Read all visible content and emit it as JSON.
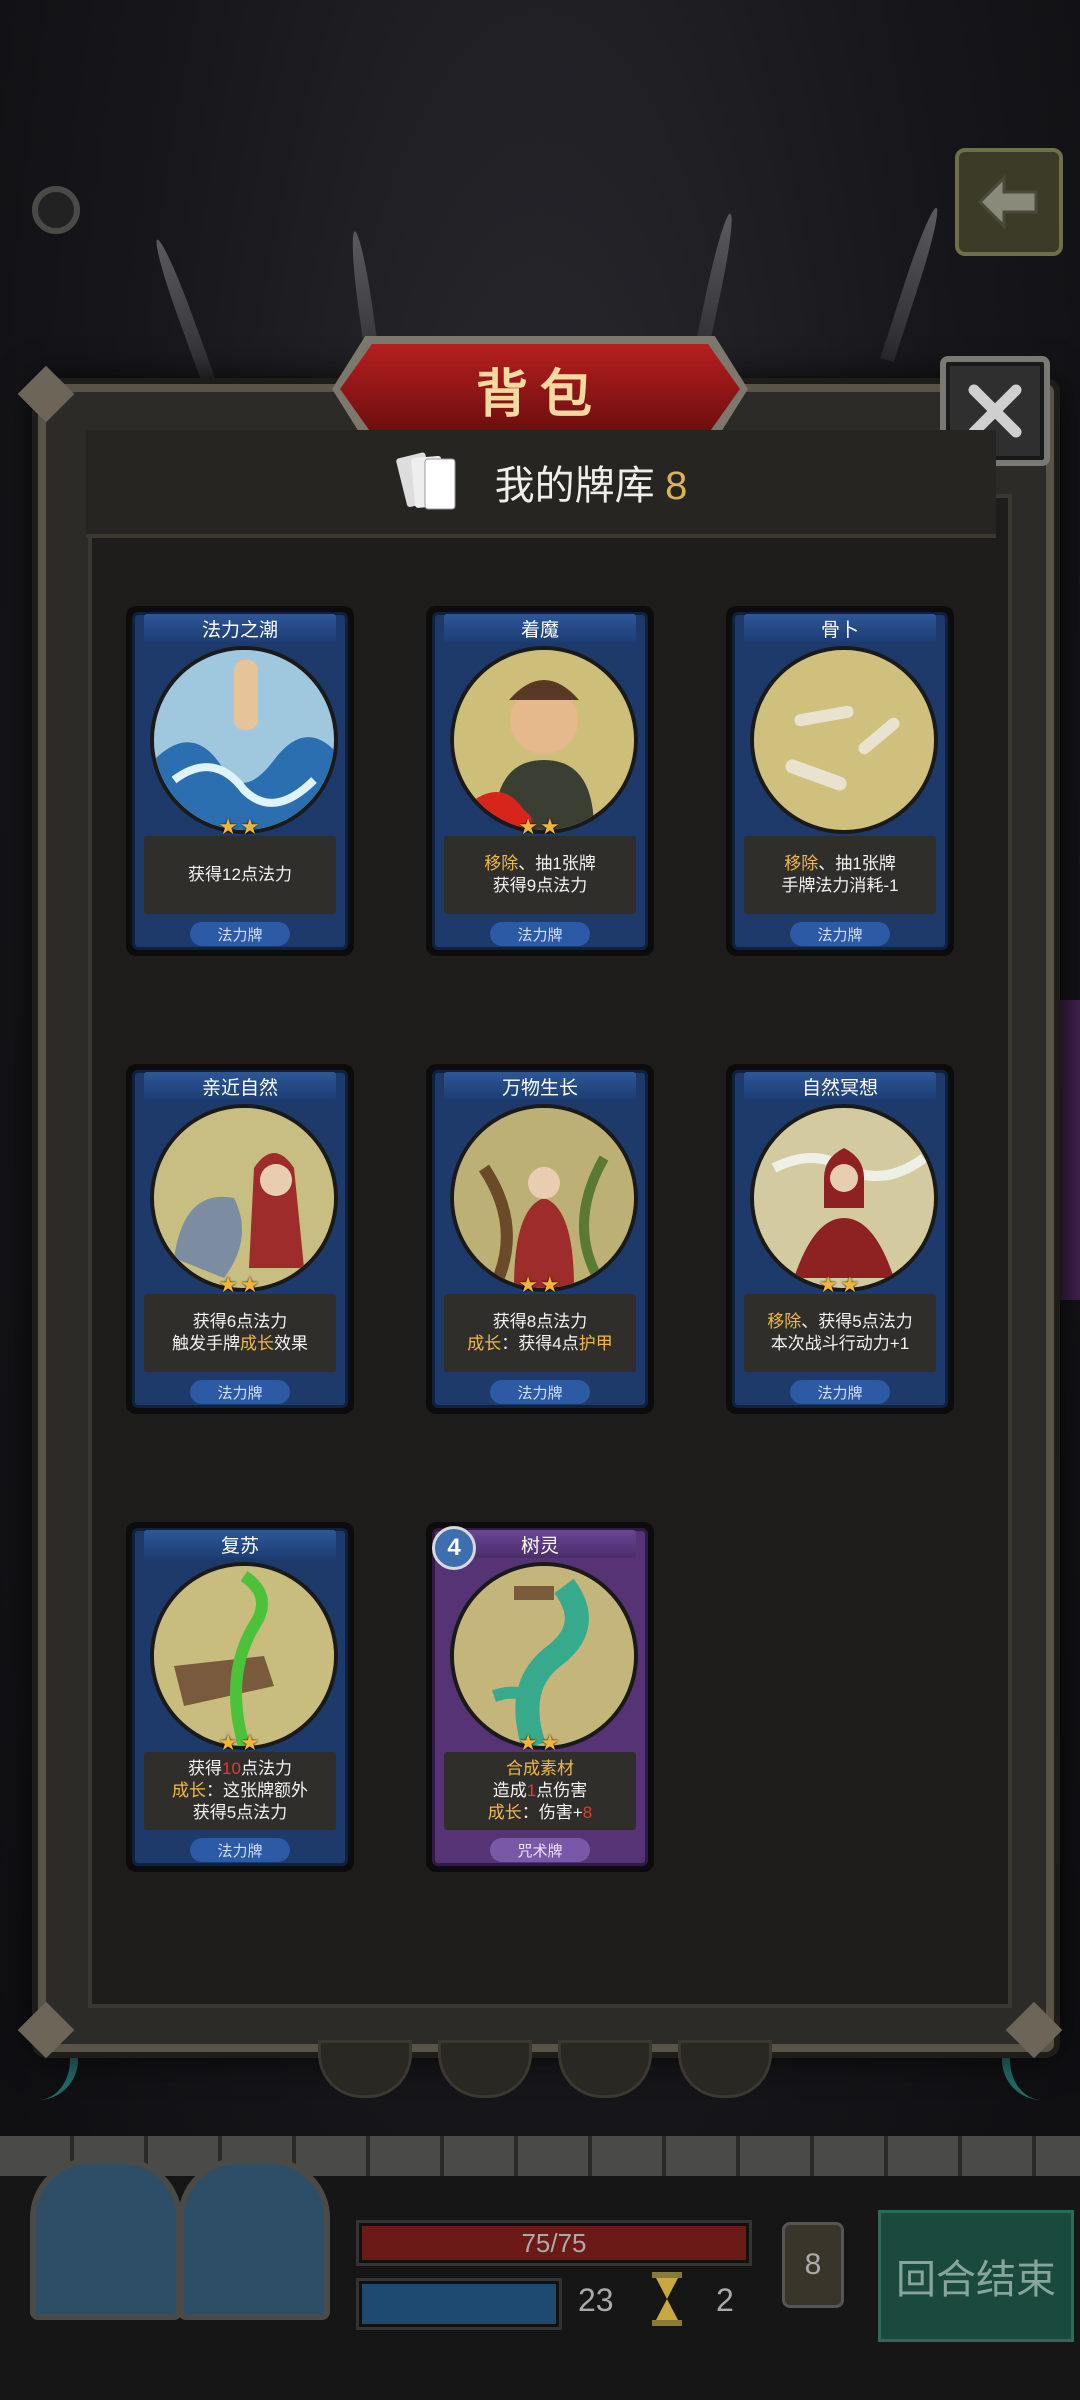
{
  "header": {
    "title": "背包"
  },
  "deck": {
    "title": "我的牌库",
    "count": "8"
  },
  "cards": [
    {
      "name": "法力之潮",
      "stars": "★★",
      "desc": [
        "获得12点法力"
      ],
      "type": "法力牌"
    },
    {
      "name": "着魔",
      "stars": "★★",
      "desc_html": [
        [
          "移除",
          "、抽1张牌"
        ],
        [
          "获得9点法力"
        ]
      ],
      "type": "法力牌"
    },
    {
      "name": "骨卜",
      "stars": "",
      "desc_html": [
        [
          "移除",
          "、抽1张牌"
        ],
        [
          "手牌法力消耗-1"
        ]
      ],
      "type": "法力牌"
    },
    {
      "name": "亲近自然",
      "stars": "★★",
      "type": "法力牌"
    },
    {
      "name": "万物生长",
      "stars": "★★",
      "type": "法力牌"
    },
    {
      "name": "自然冥想",
      "stars": "★★",
      "type": "法力牌"
    },
    {
      "name": "复苏",
      "stars": "★★",
      "type": "法力牌"
    },
    {
      "name": "树灵",
      "stars": "★★",
      "cost": "4",
      "type": "咒术牌"
    }
  ],
  "card_text": {
    "c0": "获得12点法力",
    "c1a_hl": "移除",
    "c1a": "、抽1张牌",
    "c1b": "获得9点法力",
    "c2a_hl": "移除",
    "c2a": "、抽1张牌",
    "c2b": "手牌法力消耗-1",
    "c3a": "获得6点法力",
    "c3b_pre": "触发手牌",
    "c3b_hl": "成长",
    "c3b_post": "效果",
    "c4a": "获得8点法力",
    "c4b_hl": "成长",
    "c4b_mid": "：获得4点",
    "c4b_hl2": "护甲",
    "c5a_hl": "移除",
    "c5a": "、获得5点法力",
    "c5b": "本次战斗行动力+1",
    "c6a_pre": "获得",
    "c6a_red": "10",
    "c6a_post": "点法力",
    "c6b_hl": "成长",
    "c6b": "：这张牌额外",
    "c6c": "获得5点法力",
    "c7a_hl": "合成素材",
    "c7b_pre": "造成",
    "c7b_red": "1",
    "c7b_post": "点伤害",
    "c7c_hl": "成长",
    "c7c": "：伤害+",
    "c7c_red": "8"
  },
  "hud": {
    "hp_text": "75/75",
    "mana_value": "23",
    "action_points": "2",
    "deck_count": "8",
    "end_turn_label": "回合结束"
  },
  "colors": {
    "highlight": "#f0b84a",
    "damage": "#e23b2f",
    "mana_card": "#1d3a6b",
    "curse_card": "#553375"
  },
  "icons": [
    "back-arrow-icon",
    "close-icon",
    "cards-icon",
    "star-icon",
    "hourglass-icon"
  ]
}
